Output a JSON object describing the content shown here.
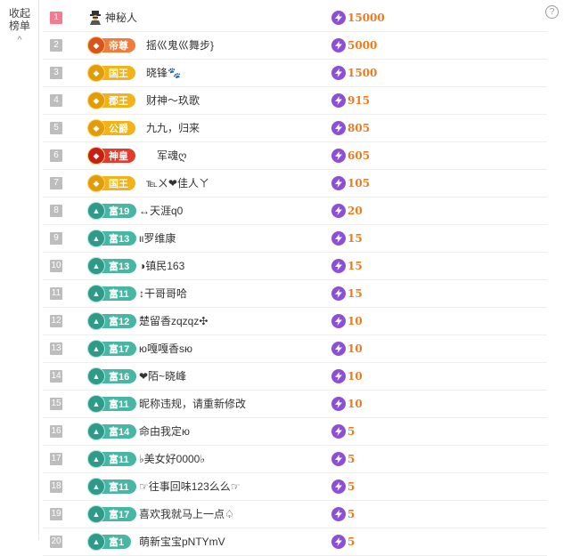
{
  "sidebar": {
    "collapse_label": "收起榜单",
    "chevron": "^"
  },
  "help": "?",
  "colors": {
    "top_rank": "#f37b8f",
    "rank": "#bdbdbd",
    "score": "#f07a1a",
    "bolt": "#8c4fd6"
  },
  "rows": [
    {
      "rank": "1",
      "badge_type": "mystery",
      "badge": "",
      "name": "神秘人",
      "score": "15000"
    },
    {
      "rank": "2",
      "badge_type": "emperor",
      "badge": "帝尊",
      "name": "摇巛鬼巛舞步}",
      "score": "5000"
    },
    {
      "rank": "3",
      "badge_type": "gold",
      "badge": "国王",
      "name": "晓锋🐾",
      "score": "1500"
    },
    {
      "rank": "4",
      "badge_type": "gold",
      "badge": "郡王",
      "name": "财神～玖歌",
      "score": "915"
    },
    {
      "rank": "5",
      "badge_type": "gold",
      "badge": "公爵",
      "name": "九九，归来",
      "score": "805"
    },
    {
      "rank": "6",
      "badge_type": "star",
      "badge": "神皇",
      "name": "军魂ღ",
      "score": "605"
    },
    {
      "rank": "7",
      "badge_type": "gold",
      "badge": "国王",
      "name": "℡ㄨ❤佳人ㄚ",
      "score": "105"
    },
    {
      "rank": "8",
      "badge_type": "rich",
      "badge": "富19",
      "name": "↔天涯q0",
      "score": "20"
    },
    {
      "rank": "9",
      "badge_type": "rich",
      "badge": "富13",
      "name": "ιι罗维康",
      "score": "15"
    },
    {
      "rank": "10",
      "badge_type": "rich",
      "badge": "富13",
      "name": "◑镇民163",
      "score": "15"
    },
    {
      "rank": "11",
      "badge_type": "rich",
      "badge": "富11",
      "name": "↕干哥哥哈",
      "score": "15"
    },
    {
      "rank": "12",
      "badge_type": "rich",
      "badge": "富12",
      "name": "楚留香zqzqz✣",
      "score": "10"
    },
    {
      "rank": "13",
      "badge_type": "rich",
      "badge": "富17",
      "name": "ю嘎嘎香sю",
      "score": "10"
    },
    {
      "rank": "14",
      "badge_type": "rich",
      "badge": "富16",
      "name": "❤陌~晓峰",
      "score": "10"
    },
    {
      "rank": "15",
      "badge_type": "rich",
      "badge": "富11",
      "name": "昵称违规，请重新修改",
      "score": "10"
    },
    {
      "rank": "16",
      "badge_type": "rich",
      "badge": "富14",
      "name": "命由我定ю",
      "score": "5"
    },
    {
      "rank": "17",
      "badge_type": "rich",
      "badge": "富11",
      "name": "♭美女好0000♭",
      "score": "5"
    },
    {
      "rank": "18",
      "badge_type": "rich",
      "badge": "富11",
      "name": "☞往事回味123么么☞",
      "score": "5"
    },
    {
      "rank": "19",
      "badge_type": "rich",
      "badge": "富17",
      "name": "喜欢我就马上一点♤",
      "score": "5"
    },
    {
      "rank": "20",
      "badge_type": "rich",
      "badge": "富1",
      "name": "萌新宝宝pNTYmV",
      "score": "5"
    }
  ]
}
